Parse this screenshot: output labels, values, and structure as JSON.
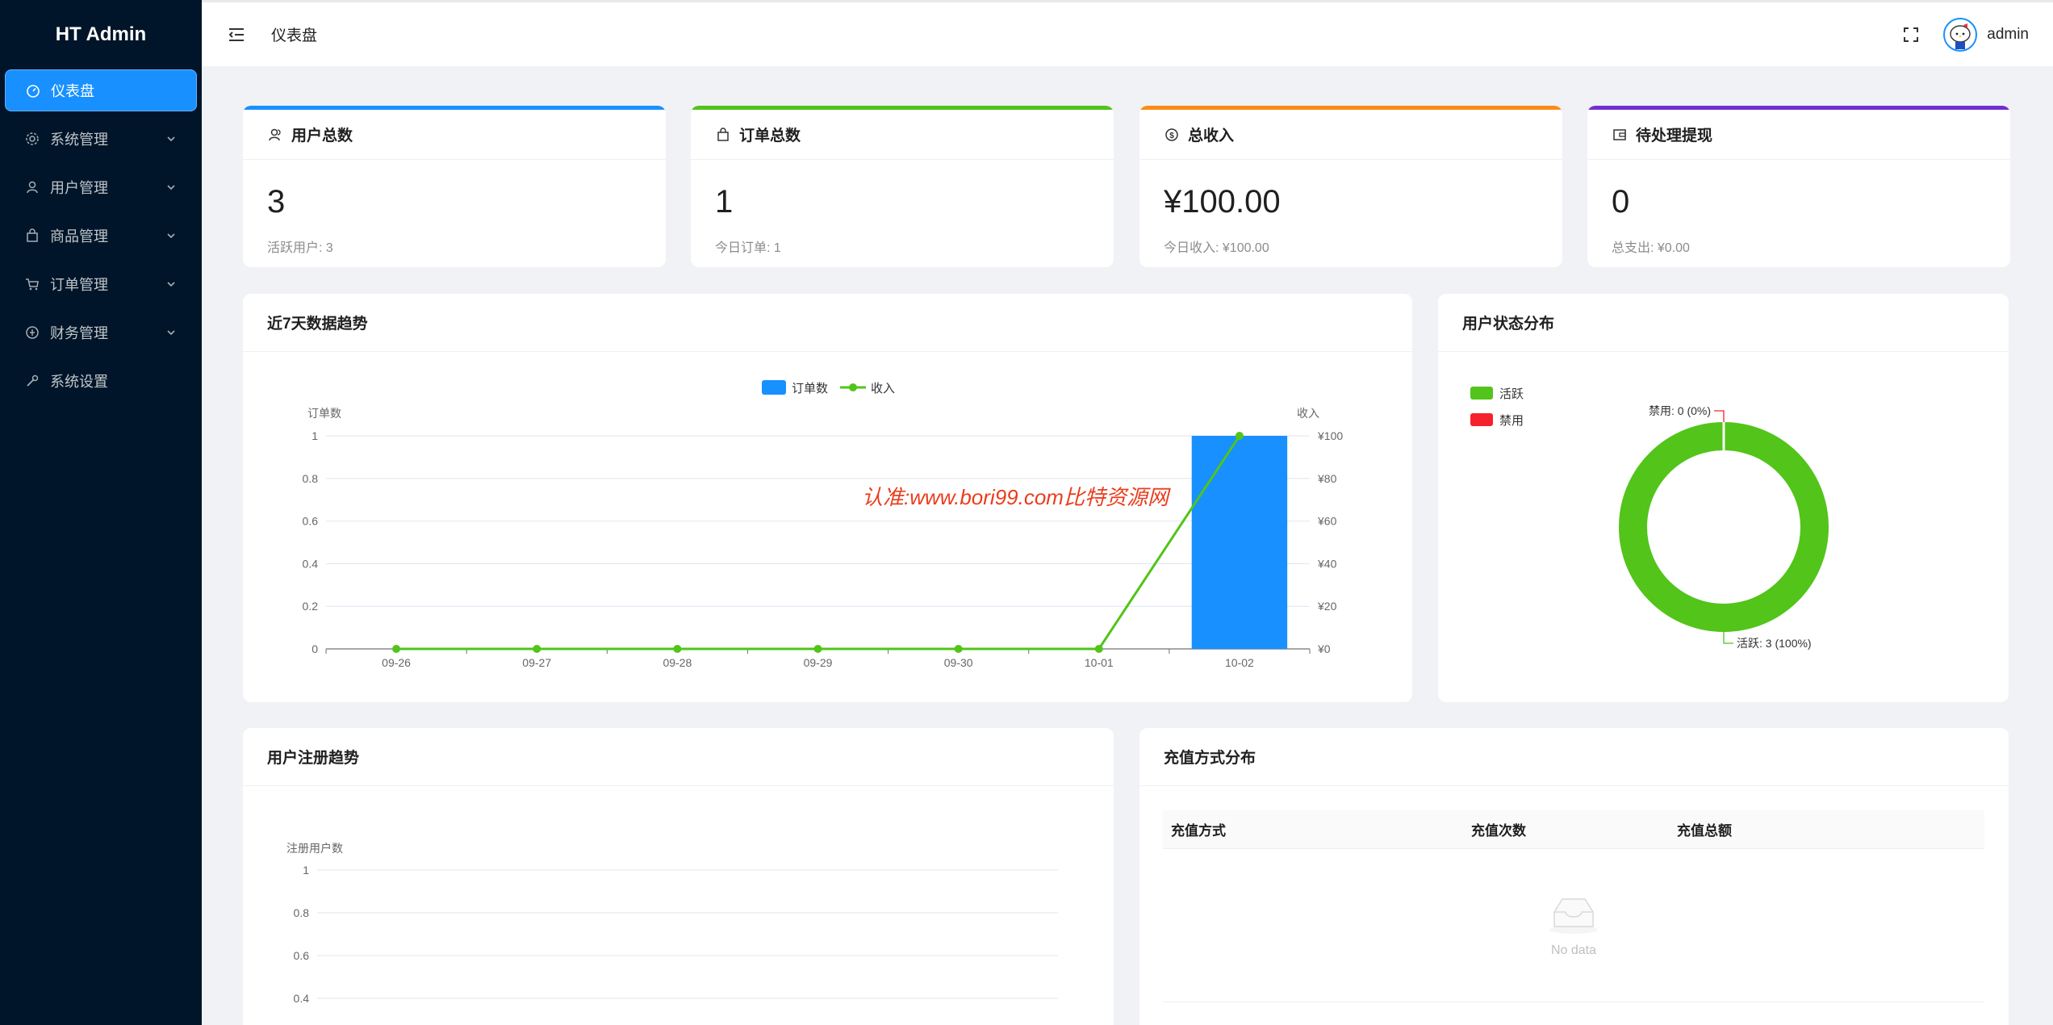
{
  "app": {
    "title": "HT Admin"
  },
  "sidebar": {
    "items": [
      {
        "label": "仪表盘",
        "icon": "dashboard-icon",
        "active": true,
        "expandable": false
      },
      {
        "label": "系统管理",
        "icon": "gear-icon",
        "active": false,
        "expandable": true
      },
      {
        "label": "用户管理",
        "icon": "user-icon",
        "active": false,
        "expandable": true
      },
      {
        "label": "商品管理",
        "icon": "shopping-bag-icon",
        "active": false,
        "expandable": true
      },
      {
        "label": "订单管理",
        "icon": "cart-icon",
        "active": false,
        "expandable": true
      },
      {
        "label": "财务管理",
        "icon": "finance-icon",
        "active": false,
        "expandable": true
      },
      {
        "label": "系统设置",
        "icon": "wrench-icon",
        "active": false,
        "expandable": false
      }
    ]
  },
  "header": {
    "breadcrumb": "仪表盘",
    "username": "admin"
  },
  "stats": [
    {
      "title": "用户总数",
      "icon": "users-icon",
      "value": "3",
      "sub": "活跃用户: 3",
      "color": "#1890ff"
    },
    {
      "title": "订单总数",
      "icon": "shopping-bag-icon",
      "value": "1",
      "sub": "今日订单: 1",
      "color": "#52c41a"
    },
    {
      "title": "总收入",
      "icon": "dollar-icon",
      "value": "¥100.00",
      "sub": "今日收入: ¥100.00",
      "color": "#fa8c16"
    },
    {
      "title": "待处理提现",
      "icon": "wallet-icon",
      "value": "0",
      "sub": "总支出: ¥0.00",
      "color": "#722ed1"
    }
  ],
  "trend": {
    "title": "近7天数据趋势"
  },
  "status": {
    "title": "用户状态分布"
  },
  "registration": {
    "title": "用户注册趋势"
  },
  "recharge": {
    "title": "充值方式分布",
    "columns": [
      "充值方式",
      "充值次数",
      "充值总额"
    ],
    "empty_text": "No data"
  },
  "watermark": "认准:www.bori99.com比特资源网",
  "chart_data": [
    {
      "type": "bar",
      "title": "近7天数据趋势",
      "categories": [
        "09-26",
        "09-27",
        "09-28",
        "09-29",
        "09-30",
        "10-01",
        "10-02"
      ],
      "series": [
        {
          "name": "订单数",
          "type": "bar",
          "axis": "left",
          "values": [
            0,
            0,
            0,
            0,
            0,
            0,
            1
          ],
          "color": "#1890ff"
        },
        {
          "name": "收入",
          "type": "line",
          "axis": "right",
          "values": [
            0,
            0,
            0,
            0,
            0,
            0,
            100
          ],
          "color": "#52c41a"
        }
      ],
      "ylabel": "订单数",
      "ylabel_right": "收入",
      "ylim": [
        0,
        1
      ],
      "ylim_right": [
        0,
        100
      ],
      "yticks": [
        "0",
        "0.2",
        "0.4",
        "0.6",
        "0.8",
        "1"
      ],
      "yticks_right": [
        "¥0",
        "¥20",
        "¥40",
        "¥60",
        "¥80",
        "¥100"
      ],
      "legend": "top-center",
      "grid": true
    },
    {
      "type": "pie",
      "title": "用户状态分布",
      "labels": [
        "活跃",
        "禁用"
      ],
      "values": [
        3,
        0
      ],
      "colors": [
        "#52c41a",
        "#f5222d"
      ],
      "slice_labels": [
        "活跃: 3 (100%)",
        "禁用: 0 (0%)"
      ],
      "legend": "top-left",
      "donut": true
    },
    {
      "type": "line",
      "title": "用户注册趋势",
      "ylabel": "注册用户数",
      "yticks": [
        "0.4",
        "0.6",
        "0.8",
        "1"
      ],
      "series": [],
      "grid": true
    }
  ]
}
